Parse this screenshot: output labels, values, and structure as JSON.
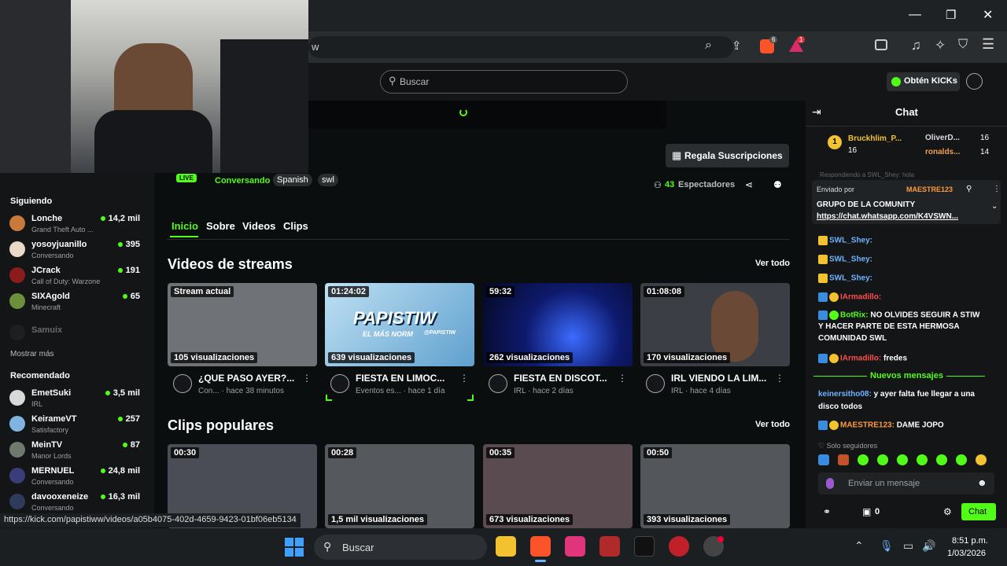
{
  "browser": {
    "url_fragment": "w",
    "title_controls": [
      "—",
      "❐",
      "✕"
    ],
    "ext_badges": [
      "6",
      "1"
    ]
  },
  "kick_header": {
    "search_placeholder": "Buscar",
    "get_kicks": "Obtén KICKs"
  },
  "stream": {
    "live_badge": "LIVE",
    "category": "Conversando",
    "tags": [
      "Spanish",
      "swl"
    ],
    "viewers_count": "43",
    "viewers_label": "Espectadores",
    "gift_subs": "Regala Suscripciones"
  },
  "channel_tabs": [
    "Inicio",
    "Sobre",
    "Videos",
    "Clips"
  ],
  "sidebar": {
    "following_title": "Siguiendo",
    "following": [
      {
        "name": "Lonche",
        "sub": "Grand Theft Auto ...",
        "count": "14,2 mil",
        "color": "#c97a3a"
      },
      {
        "name": "yosoyjuanillo",
        "sub": "Conversando",
        "count": "395",
        "color": "#e8d9c8"
      },
      {
        "name": "JCrack",
        "sub": "Call of Duty: Warzone",
        "count": "191",
        "color": "#8a1c1c"
      },
      {
        "name": "SIXAgold",
        "sub": "Minecraft",
        "count": "65",
        "color": "#6b8f3a"
      }
    ],
    "offline": "Samuix",
    "show_more": "Mostrar más",
    "recommended_title": "Recomendado",
    "recommended": [
      {
        "name": "EmetSuki",
        "sub": "IRL",
        "count": "3,5 mil",
        "color": "#d9d9d9"
      },
      {
        "name": "KeirameVT",
        "sub": "Satisfactory",
        "count": "257",
        "color": "#7fb3e0"
      },
      {
        "name": "MeinTV",
        "sub": "Manor Lords",
        "count": "87",
        "color": "#6f7a6f"
      },
      {
        "name": "MERNUEL",
        "sub": "Conversando",
        "count": "24,8 mil",
        "color": "#3a3d7a"
      },
      {
        "name": "davooxeneize",
        "sub": "Conversando",
        "count": "16,3 mil",
        "color": "#2e3b5a"
      }
    ]
  },
  "videos_section": {
    "title": "Videos de streams",
    "see_all": "Ver todo",
    "items": [
      {
        "dur": "Stream actual",
        "views": "105 visualizaciones",
        "title": "¿QUE PASO AYER?...",
        "meta": "Con... · hace 38 minutos",
        "bg": "#6f7377"
      },
      {
        "dur": "01:24:02",
        "views": "639 visualizaciones",
        "title": "FIESTA EN LIMOC...",
        "meta": "Eventos es... · hace 1 día",
        "bg": "#7fb4d6",
        "overlay": "PAPISTIW",
        "overlay2": "EL MÁS NORM",
        "overlay3": "@PAPISTIW"
      },
      {
        "dur": "59:32",
        "views": "262 visualizaciones",
        "title": "FIESTA EN DISCOT...",
        "meta": "IRL · hace 2 días",
        "bg": "#0e1a6e"
      },
      {
        "dur": "01:08:08",
        "views": "170 visualizaciones",
        "title": "IRL VIENDO LA LIM...",
        "meta": "IRL · hace 4 días",
        "bg": "#3b3f45"
      }
    ]
  },
  "clips_section": {
    "title": "Clips populares",
    "see_all": "Ver todo",
    "items": [
      {
        "dur": "00:30",
        "views": "",
        "bg": "#4a4d55"
      },
      {
        "dur": "00:28",
        "views": "1,5 mil visualizaciones",
        "bg": "#55585c"
      },
      {
        "dur": "00:35",
        "views": "673 visualizaciones",
        "bg": "#5a4b50"
      },
      {
        "dur": "00:50",
        "views": "393 visualizaciones",
        "bg": "#53575c"
      }
    ]
  },
  "status_url": "https://kick.com/papistiww/videos/a05b4075-402d-4659-9423-01bf06eb5134",
  "chat": {
    "title": "Chat",
    "leaderboard": [
      {
        "rank": "1",
        "name": "Bruckhlim_P...",
        "count": "16"
      },
      {
        "name": "OliverD...",
        "count": "16"
      },
      {
        "name": "ronalds...",
        "count": "14"
      }
    ],
    "reply_hint": "Respondiendo a SWL_Shey: hola",
    "pinned": {
      "by_label": "Enviado por",
      "by_user": "MAESTRE123",
      "text": "GRUPO DE LA COMUNITY",
      "link": "https://chat.whatsapp.com/K4VSWN..."
    },
    "messages": [
      {
        "user": "SWL_Shey:",
        "text": "",
        "ucolor": "#6fb3ff"
      },
      {
        "user": "SWL_Shey:",
        "text": "",
        "ucolor": "#6fb3ff"
      },
      {
        "user": "SWL_Shey:",
        "text": "",
        "ucolor": "#6fb3ff"
      },
      {
        "user": "IArmadillo:",
        "text": "",
        "ucolor": "#ff4d4d"
      },
      {
        "user": "BotRix:",
        "text": "NO OLVIDES SEGUIR A STIW",
        "ucolor": "#53fc18"
      },
      {
        "user": "",
        "text": "Y HACER PARTE DE ESTA HERMOSA",
        "ucolor": "#fff"
      },
      {
        "user": "",
        "text": "COMUNIDAD SWL",
        "ucolor": "#fff"
      },
      {
        "user": "IArmadillo:",
        "text": "fredes",
        "ucolor": "#ff4d4d"
      }
    ],
    "new_messages": "Nuevos mensajes",
    "messages2": [
      {
        "user": "keinersitho08:",
        "text": "y ayer falta fue llegar a una",
        "ucolor": "#6fb3ff"
      },
      {
        "user": "",
        "text": "disco todos",
        "ucolor": "#fff"
      },
      {
        "user": "MAESTRE123:",
        "text": "DAME JOPO",
        "ucolor": "#ff9a3c"
      }
    ],
    "followers_only": "Solo seguidores",
    "input_placeholder": "Enviar un mensaje",
    "kicks_count": "0",
    "send": "Chat"
  },
  "taskbar": {
    "search": "Buscar",
    "time": "8:51 p.m.",
    "date": "1/03/2026"
  }
}
